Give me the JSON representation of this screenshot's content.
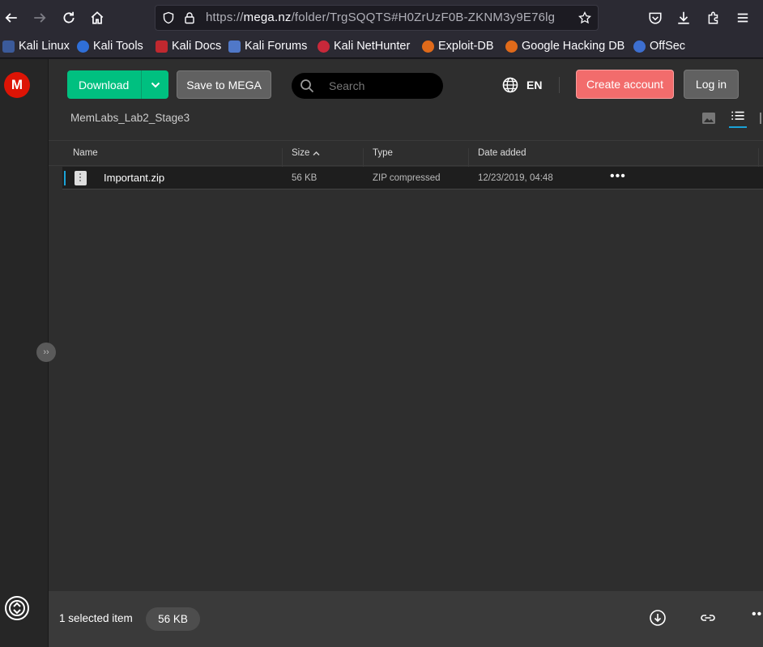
{
  "browser": {
    "url_scheme": "https://",
    "url_host": "mega.nz",
    "url_path": "/folder/TrgSQQTS#H0ZrUzF0B-ZKNM3y9E76lg"
  },
  "bookmarks": [
    {
      "label": "Kali Linux"
    },
    {
      "label": "Kali Tools"
    },
    {
      "label": "Kali Docs"
    },
    {
      "label": "Kali Forums"
    },
    {
      "label": "Kali NetHunter"
    },
    {
      "label": "Exploit-DB"
    },
    {
      "label": "Google Hacking DB"
    },
    {
      "label": "OffSec"
    }
  ],
  "mega": {
    "logo_letter": "M",
    "download_label": "Download",
    "save_label": "Save to MEGA",
    "search_placeholder": "Search",
    "language": "EN",
    "create_account_label": "Create account",
    "login_label": "Log in",
    "breadcrumb": "MemLabs_Lab2_Stage3",
    "columns": {
      "name": "Name",
      "size": "Size",
      "type": "Type",
      "date": "Date added"
    },
    "files": [
      {
        "name": "Important.zip",
        "size": "56 KB",
        "type": "ZIP compressed",
        "date": "12/23/2019, 04:48"
      }
    ],
    "footer": {
      "selected_text": "1 selected item",
      "selected_size": "56 KB"
    },
    "colors": {
      "accent": "#00c080",
      "create": "#f26c6c",
      "logo": "#dd1405",
      "selection": "#1aa3d8"
    }
  }
}
